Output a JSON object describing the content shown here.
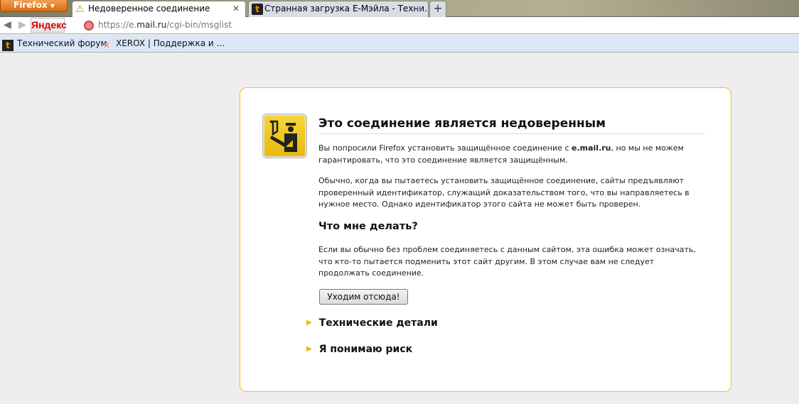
{
  "browser": {
    "menu_label": "Firefox"
  },
  "tabs": [
    {
      "title": "Недоверенное соединение",
      "icon": "warning-icon",
      "active": true
    },
    {
      "title": "Странная загрузка E-Мэйла - Техни...",
      "icon": "forum-icon",
      "active": false
    }
  ],
  "navbar": {
    "search_engine": "Яндекс",
    "url_prefix": "https://e.",
    "url_domain": "mail.ru",
    "url_path": "/cgi-bin/msglist"
  },
  "bookmarks": [
    {
      "label": "Технический форум",
      "icon": "forum-icon"
    },
    {
      "label": "XEROX | Поддержка и ...",
      "icon": "xerox-icon"
    }
  ],
  "error": {
    "title": "Это соединение является недоверенным",
    "p1_before": "Вы попросили Firefox установить защищённое соединение с ",
    "p1_host": "e.mail.ru",
    "p1_after": ", но мы не можем гарантировать, что это соединение является защищённым.",
    "p2": "Обычно, когда вы пытаетесь установить защищённое соединение, сайты предъявляют проверенный идентификатор, служащий доказательством того, что вы направляетесь в нужное место. Однако идентификатор этого сайта не может быть проверен.",
    "what_title": "Что мне делать?",
    "p3": "Если вы обычно без проблем соединяетесь с данным сайтом, эта ошибка может означать, что кто-то пытается подменить этот сайт другим. В этом случае вам не следует продолжать соединение.",
    "leave_button": "Уходим отсюда!",
    "tech_details": "Технические детали",
    "understand_risk": "Я понимаю риск"
  },
  "colors": {
    "card_border": "#f3bd22",
    "accent": "#f0b400"
  }
}
